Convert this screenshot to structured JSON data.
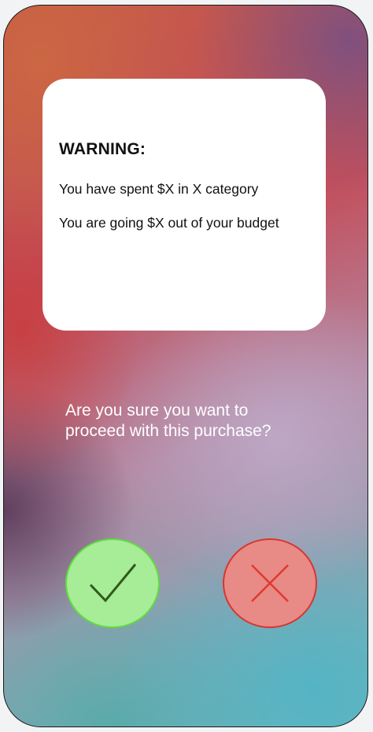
{
  "warning_card": {
    "title": "WARNING:",
    "line1": "You have spent $X in X category",
    "line2": "You are going $X out of your budget"
  },
  "prompt": {
    "line1": "Are you sure you want to",
    "line2": "proceed with this purchase?"
  },
  "buttons": {
    "confirm_icon": "checkmark-icon",
    "cancel_icon": "x-icon"
  },
  "colors": {
    "confirm_fill": "#a7ec96",
    "confirm_border": "#5fdc40",
    "cancel_fill": "#e88a86",
    "cancel_border": "#d8362e"
  }
}
